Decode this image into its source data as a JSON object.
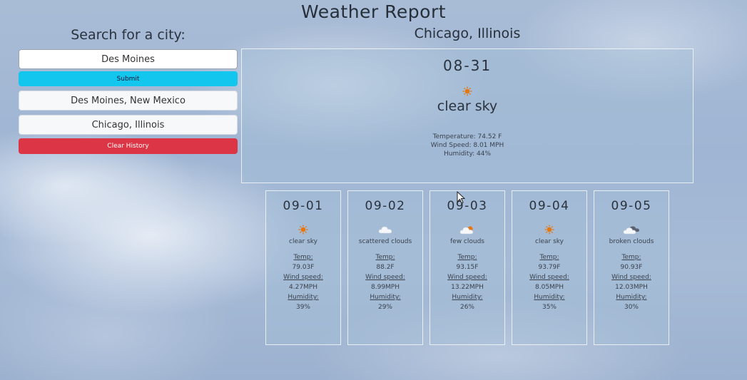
{
  "page": {
    "title": "Weather Report"
  },
  "search": {
    "heading": "Search for a city:",
    "input_value": "Des Moines",
    "submit_label": "Submit",
    "history": [
      "Des Moines, New Mexico",
      "Chicago, Illinois"
    ],
    "clear_label": "Clear History"
  },
  "current": {
    "city": "Chicago, Illinois",
    "date": "08-31",
    "icon": "sun-icon",
    "description": "clear sky",
    "temperature": "Temperature: 74.52 F",
    "wind": "Wind Speed: 8.01 MPH",
    "humidity": "Humidity: 44%"
  },
  "forecast": [
    {
      "date": "09-01",
      "icon": "sun-icon",
      "description": "clear sky",
      "temp_label": "Temp:",
      "temp": "79.03F",
      "wind_label": "Wind speed:",
      "wind": "4.27MPH",
      "humidity_label": "Humidity:",
      "humidity": "39%"
    },
    {
      "date": "09-02",
      "icon": "cloud-icon",
      "description": "scattered clouds",
      "temp_label": "Temp:",
      "temp": "88.2F",
      "wind_label": "Wind speed:",
      "wind": "8.99MPH",
      "humidity_label": "Humidity:",
      "humidity": "29%"
    },
    {
      "date": "09-03",
      "icon": "few-clouds-icon",
      "description": "few clouds",
      "temp_label": "Temp:",
      "temp": "93.15F",
      "wind_label": "Wind speed:",
      "wind": "13.22MPH",
      "humidity_label": "Humidity:",
      "humidity": "26%"
    },
    {
      "date": "09-04",
      "icon": "sun-icon",
      "description": "clear sky",
      "temp_label": "Temp:",
      "temp": "93.79F",
      "wind_label": "Wind speed:",
      "wind": "8.05MPH",
      "humidity_label": "Humidity:",
      "humidity": "35%"
    },
    {
      "date": "09-05",
      "icon": "broken-clouds-icon",
      "description": "broken clouds",
      "temp_label": "Temp:",
      "temp": "90.93F",
      "wind_label": "Wind speed:",
      "wind": "12.03MPH",
      "humidity_label": "Humidity:",
      "humidity": "30%"
    }
  ],
  "colors": {
    "submit": "#12c6ee",
    "clear": "#dc3545",
    "sun": "#e6760e"
  }
}
